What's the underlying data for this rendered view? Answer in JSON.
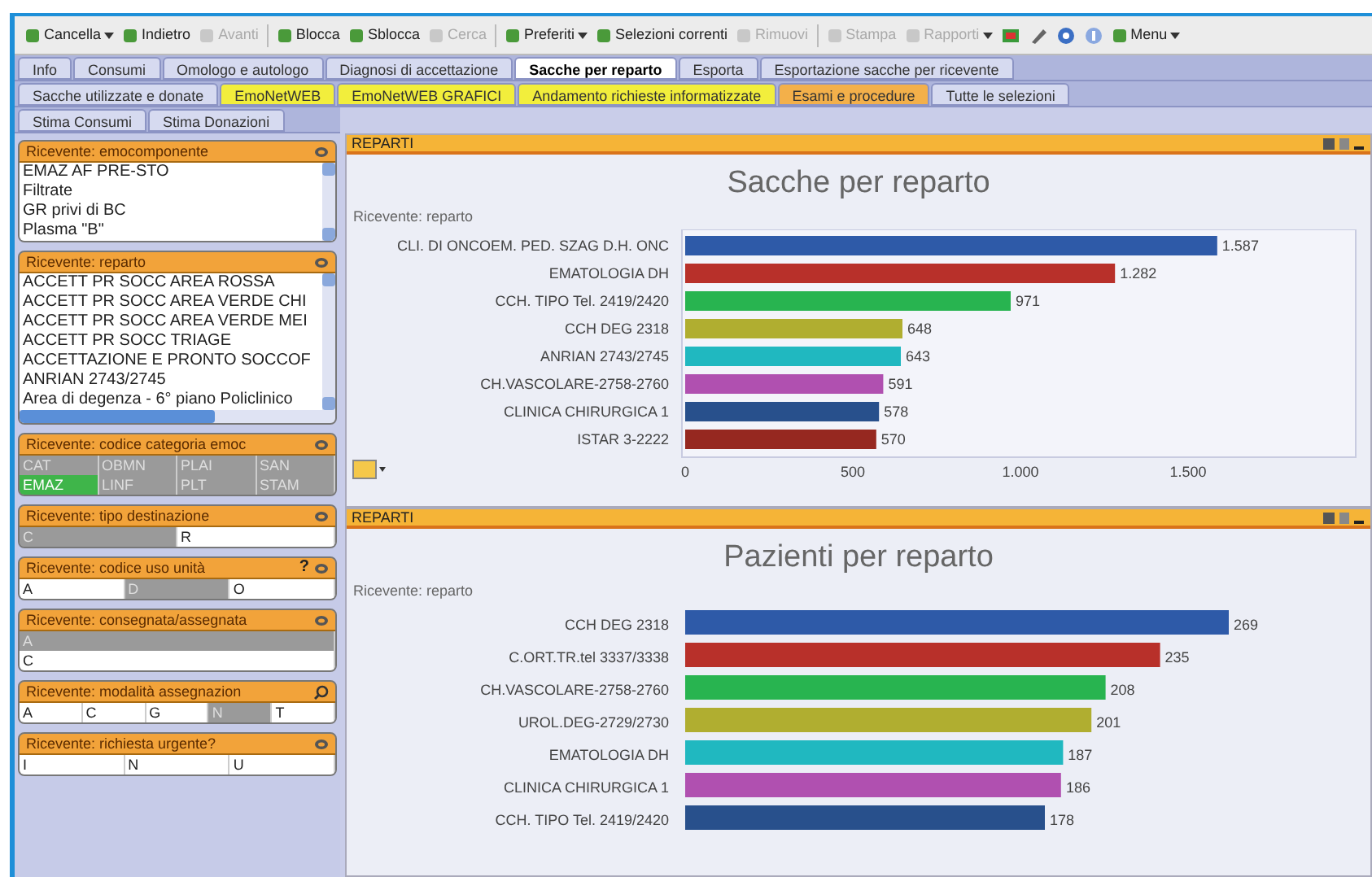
{
  "toolbar": [
    {
      "kind": "dropdown",
      "label": "Cancella",
      "disabled": false
    },
    {
      "kind": "button",
      "label": "Indietro",
      "disabled": false
    },
    {
      "kind": "button",
      "label": "Avanti",
      "disabled": true
    },
    {
      "kind": "button",
      "label": "Blocca",
      "disabled": false
    },
    {
      "kind": "button",
      "label": "Sblocca",
      "disabled": false
    },
    {
      "kind": "button",
      "label": "Cerca",
      "disabled": true
    },
    {
      "kind": "dropdown",
      "label": "Preferiti",
      "disabled": false
    },
    {
      "kind": "button",
      "label": "Selezioni correnti",
      "disabled": false
    },
    {
      "kind": "button",
      "label": "Rimuovi",
      "disabled": true
    },
    {
      "kind": "button",
      "label": "Stampa",
      "disabled": true
    },
    {
      "kind": "dropdown",
      "label": "Rapporti",
      "disabled": true
    },
    {
      "kind": "icon"
    },
    {
      "kind": "icon"
    },
    {
      "kind": "icon"
    },
    {
      "kind": "icon"
    },
    {
      "kind": "dropdown",
      "label": "Menu",
      "disabled": false
    }
  ],
  "tab_rows": [
    [
      {
        "label": "Info",
        "selected": false,
        "color": "#d6daf0"
      },
      {
        "label": "Consumi",
        "selected": false,
        "color": "#d6daf0"
      },
      {
        "label": "Omologo e autologo",
        "selected": false,
        "color": "#d6daf0"
      },
      {
        "label": "Diagnosi di accettazione",
        "selected": false,
        "color": "#d6daf0"
      },
      {
        "label": "Sacche per reparto",
        "selected": true,
        "color": "#ffffff"
      },
      {
        "label": "Esporta",
        "selected": false,
        "color": "#d6daf0"
      },
      {
        "label": "Esportazione sacche per ricevente",
        "selected": false,
        "color": "#d6daf0"
      }
    ],
    [
      {
        "label": "Sacche utilizzate e donate",
        "selected": false,
        "color": "#d6daf0"
      },
      {
        "label": "EmoNetWEB",
        "selected": false,
        "color": "#f2ee3c"
      },
      {
        "label": "EmoNetWEB GRAFICI",
        "selected": false,
        "color": "#f2ee3c"
      },
      {
        "label": "Andamento richieste informatizzate",
        "selected": false,
        "color": "#f2ee3c"
      },
      {
        "label": "Esami e procedure",
        "selected": false,
        "color": "#f3b04a"
      },
      {
        "label": "Tutte le selezioni",
        "selected": false,
        "color": "#d6daf0"
      }
    ],
    [
      {
        "label": "Stima Consumi",
        "selected": false,
        "color": "#d6daf0"
      },
      {
        "label": "Stima Donazioni",
        "selected": false,
        "color": "#d6daf0"
      }
    ]
  ],
  "listboxes": [
    {
      "title": "Ricevente: emocomponente",
      "kind": "list",
      "searchable": false,
      "items": [
        "EMAZ AF PRE-STO",
        "Filtrate",
        "GR privi di BC",
        "Plasma \"B\""
      ]
    },
    {
      "title": "Ricevente: reparto",
      "kind": "list",
      "searchable": false,
      "items": [
        "ACCETT PR SOCC AREA ROSSA",
        "ACCETT PR SOCC AREA VERDE CHI",
        "ACCETT PR SOCC AREA VERDE MEI",
        "ACCETT PR SOCC TRIAGE",
        "ACCETTAZIONE E PRONTO SOCCOF",
        "ANRIAN 2743/2745",
        "Area di degenza - 6° piano Policlinico"
      ]
    },
    {
      "title": "Ricevente: codice categoria emoc",
      "kind": "grid",
      "searchable": false,
      "rows": [
        [
          {
            "label": "CAT",
            "selected": false,
            "excluded": true
          },
          {
            "label": "OBMN",
            "selected": false,
            "excluded": true
          },
          {
            "label": "PLAI",
            "selected": false,
            "excluded": true
          },
          {
            "label": "SAN",
            "selected": false,
            "excluded": true
          }
        ],
        [
          {
            "label": "EMAZ",
            "selected": true,
            "excluded": false
          },
          {
            "label": "LINF",
            "selected": false,
            "excluded": true
          },
          {
            "label": "PLT",
            "selected": false,
            "excluded": true
          },
          {
            "label": "STAM",
            "selected": false,
            "excluded": true
          }
        ]
      ]
    },
    {
      "title": "Ricevente: tipo destinazione",
      "kind": "grid",
      "searchable": false,
      "rows": [
        [
          {
            "label": "C",
            "selected": false,
            "excluded": true
          },
          {
            "label": "R",
            "selected": false,
            "excluded": false
          }
        ]
      ]
    },
    {
      "title": "Ricevente: codice uso unità",
      "kind": "grid",
      "searchable": false,
      "help": "?",
      "rows": [
        [
          {
            "label": "A",
            "selected": false,
            "excluded": false
          },
          {
            "label": "D",
            "selected": false,
            "excluded": true
          },
          {
            "label": "O",
            "selected": false,
            "excluded": false
          }
        ]
      ]
    },
    {
      "title": "Ricevente: consegnata/assegnata",
      "kind": "grid",
      "searchable": false,
      "rows": [
        [
          {
            "label": "A",
            "selected": false,
            "excluded": true
          }
        ],
        [
          {
            "label": "C",
            "selected": false,
            "excluded": false
          }
        ]
      ]
    },
    {
      "title": "Ricevente: modalità assegnazion",
      "kind": "grid",
      "searchable": true,
      "rows": [
        [
          {
            "label": "A",
            "selected": false,
            "excluded": false
          },
          {
            "label": "C",
            "selected": false,
            "excluded": false
          },
          {
            "label": "G",
            "selected": false,
            "excluded": false
          },
          {
            "label": "N",
            "selected": false,
            "excluded": true
          },
          {
            "label": "T",
            "selected": false,
            "excluded": false
          }
        ]
      ]
    },
    {
      "title": "Ricevente: richiesta urgente?",
      "kind": "grid",
      "searchable": false,
      "rows": [
        [
          {
            "label": "I",
            "selected": false,
            "excluded": false
          },
          {
            "label": "N",
            "selected": false,
            "excluded": false
          },
          {
            "label": "U",
            "selected": false,
            "excluded": false
          }
        ]
      ]
    }
  ],
  "panels": [
    {
      "title": "REPARTI",
      "chart_data": {
        "type": "bar",
        "orientation": "horizontal",
        "title": "Sacche per reparto",
        "ylabel": "Ricevente: reparto",
        "categories": [
          "CLI. DI ONCOEM. PED. SZAG D.H. ONC",
          "EMATOLOGIA DH",
          "CCH. TIPO Tel. 2419/2420",
          "CCH DEG 2318",
          "ANRIAN 2743/2745",
          "CH.VASCOLARE-2758-2760",
          "CLINICA CHIRURGICA 1",
          "ISTAR 3-2222"
        ],
        "xlim": [
          0,
          2000
        ],
        "series": [
          {
            "colors": [
              "#2e5aa8",
              "#b8302a",
              "#28b450",
              "#b0ae30",
              "#20b8c0",
              "#b050b0",
              "#28508c",
              "#962820"
            ],
            "values": [
              1587,
              1282,
              971,
              648,
              643,
              591,
              578,
              570
            ]
          }
        ],
        "value_labels": [
          "1.587",
          "1.282",
          "971",
          "648",
          "643",
          "591",
          "578",
          "570"
        ],
        "xticks": [
          {
            "value": 0,
            "label": "0"
          },
          {
            "value": 500,
            "label": "500"
          },
          {
            "value": 1000,
            "label": "1.000"
          },
          {
            "value": 1500,
            "label": "1.500"
          }
        ]
      }
    },
    {
      "title": "REPARTI",
      "chart_data": {
        "type": "bar",
        "orientation": "horizontal",
        "title": "Pazienti per reparto",
        "ylabel": "Ricevente: reparto",
        "categories": [
          "CCH DEG 2318",
          "C.ORT.TR.tel 3337/3338",
          "CH.VASCOLARE-2758-2760",
          "UROL.DEG-2729/2730",
          "EMATOLOGIA DH",
          "CLINICA CHIRURGICA 1",
          "CCH. TIPO Tel. 2419/2420"
        ],
        "series": [
          {
            "colors": [
              "#2e5aa8",
              "#b8302a",
              "#28b450",
              "#b0ae30",
              "#20b8c0",
              "#b050b0",
              "#28508c"
            ],
            "values": [
              269,
              235,
              208,
              201,
              187,
              186,
              178
            ]
          }
        ],
        "data_labels": true
      }
    }
  ]
}
